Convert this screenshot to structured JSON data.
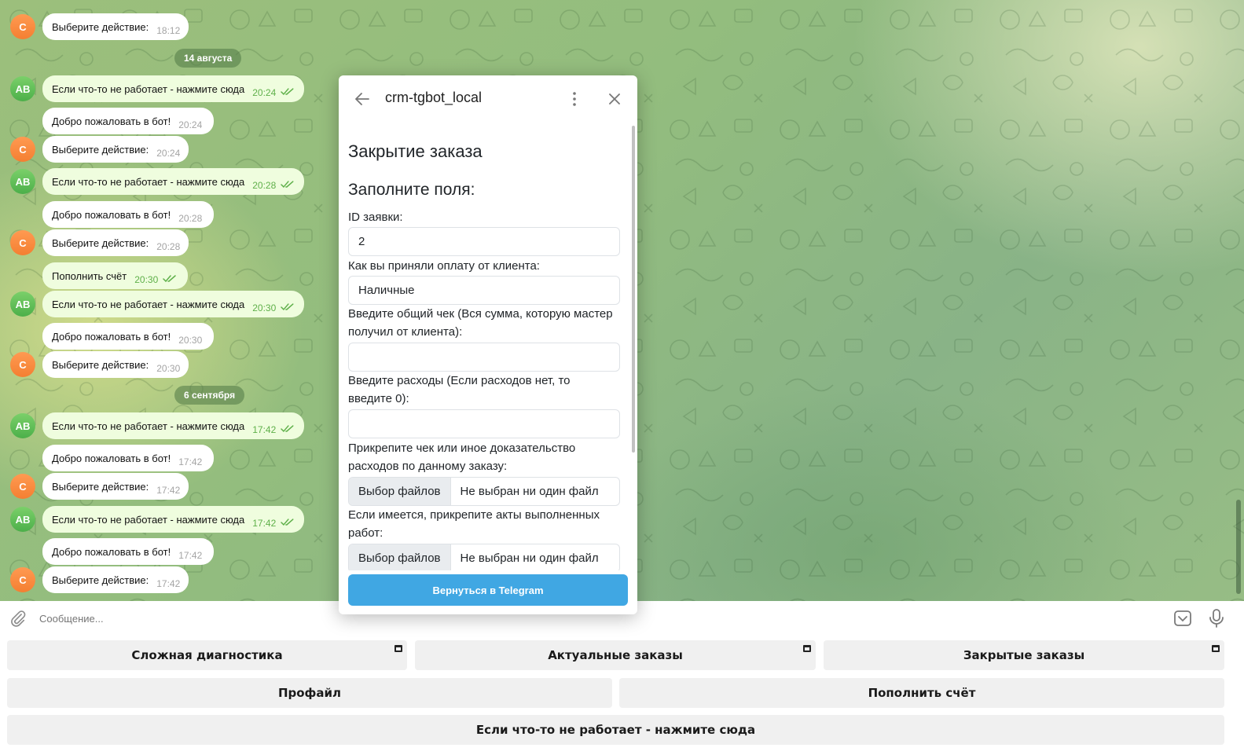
{
  "chat": {
    "messages": [
      {
        "avatar": "С",
        "avatar_type": "c",
        "text": "Выберите действие:",
        "time": "18:12",
        "dir": "in"
      },
      {
        "type": "date",
        "text": "14 августа"
      },
      {
        "avatar": "АВ",
        "avatar_type": "ab",
        "text": "Если что-то не работает - нажмите сюда",
        "time": "20:24",
        "dir": "out"
      },
      {
        "text": "Добро пожаловать в бот!",
        "time": "20:24",
        "dir": "in"
      },
      {
        "avatar": "С",
        "avatar_type": "c",
        "text": "Выберите действие:",
        "time": "20:24",
        "dir": "in"
      },
      {
        "avatar": "АВ",
        "avatar_type": "ab",
        "text": "Если что-то не работает - нажмите сюда",
        "time": "20:28",
        "dir": "out"
      },
      {
        "text": "Добро пожаловать в бот!",
        "time": "20:28",
        "dir": "in"
      },
      {
        "avatar": "С",
        "avatar_type": "c",
        "text": "Выберите действие:",
        "time": "20:28",
        "dir": "in"
      },
      {
        "text": "Пополнить счёт",
        "time": "20:30",
        "dir": "out"
      },
      {
        "avatar": "АВ",
        "avatar_type": "ab",
        "text": "Если что-то не работает - нажмите сюда",
        "time": "20:30",
        "dir": "out"
      },
      {
        "text": "Добро пожаловать в бот!",
        "time": "20:30",
        "dir": "in"
      },
      {
        "avatar": "С",
        "avatar_type": "c",
        "text": "Выберите действие:",
        "time": "20:30",
        "dir": "in"
      },
      {
        "type": "date",
        "text": "6 сентября"
      },
      {
        "avatar": "АВ",
        "avatar_type": "ab",
        "text": "Если что-то не работает - нажмите сюда",
        "time": "17:42",
        "dir": "out"
      },
      {
        "text": "Добро пожаловать в бот!",
        "time": "17:42",
        "dir": "in"
      },
      {
        "avatar": "С",
        "avatar_type": "c",
        "text": "Выберите действие:",
        "time": "17:42",
        "dir": "in"
      },
      {
        "avatar": "АВ",
        "avatar_type": "ab",
        "text": "Если что-то не работает - нажмите сюда",
        "time": "17:42",
        "dir": "out"
      },
      {
        "text": "Добро пожаловать в бот!",
        "time": "17:42",
        "dir": "in"
      },
      {
        "avatar": "С",
        "avatar_type": "c",
        "text": "Выберите действие:",
        "time": "17:42",
        "dir": "in"
      }
    ]
  },
  "dialog": {
    "title": "crm-tgbot_local",
    "heading": "Закрытие заказа",
    "subheading": "Заполните поля:",
    "fields": {
      "id_label": "ID заявки:",
      "id_value": "2",
      "payment_label": "Как вы приняли оплату от клиента:",
      "payment_value": "Наличные",
      "total_label": "Введите общий чек (Вся сумма, которую мастер получил от клиента):",
      "total_value": "",
      "expenses_label": "Введите расходы (Если расходов нет, то введите 0):",
      "expenses_value": "",
      "receipt_label": "Прикрепите чек или иное доказательство расходов по данному заказу:",
      "acts_label": "Если имеется, прикрепите акты выполненных работ:",
      "file_button": "Выбор файлов",
      "file_none": "Не выбран ни один файл"
    },
    "return_button": "Вернуться в Telegram",
    "icons": {
      "back": "arrow-left-icon",
      "more": "more-vertical-icon",
      "close": "close-icon"
    }
  },
  "composer": {
    "placeholder": "Сообщение...",
    "icons": {
      "attach": "paperclip-icon",
      "keyboard": "keyboard-toggle-icon",
      "mic": "microphone-icon"
    }
  },
  "keyboard": {
    "row1": [
      "Сложная диагностика",
      "Актуальные заказы",
      "Закрытые заказы"
    ],
    "row2": [
      "Профайл",
      "Пополнить счёт"
    ],
    "row3": [
      "Если что-то не работает - нажмите сюда"
    ]
  },
  "colors": {
    "accent": "#40a7e3",
    "outgoing_bubble": "#effdde",
    "avatar_ab": "#4caf4a",
    "avatar_c": "#f47f32"
  }
}
